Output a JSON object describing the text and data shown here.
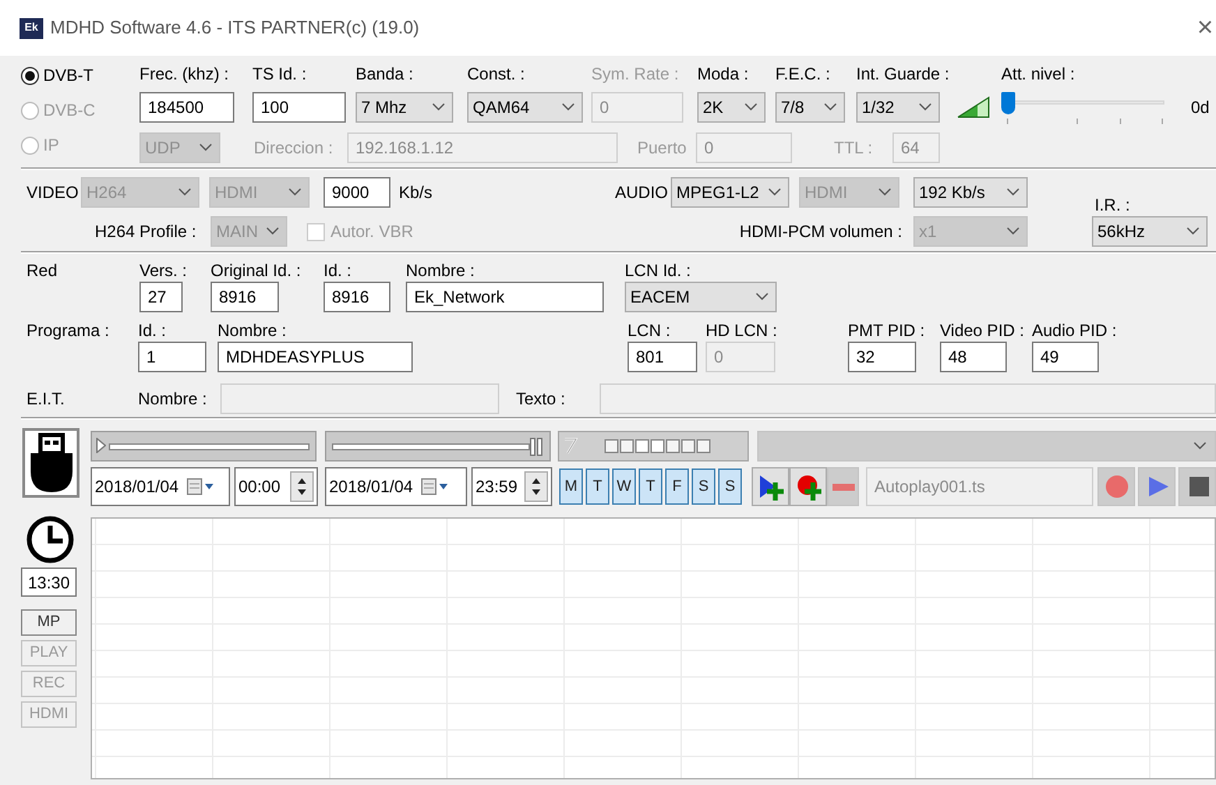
{
  "window": {
    "logo": "Ek",
    "title": "MDHD Software 4.6 - ITS PARTNER(c) (19.0)",
    "close": "×"
  },
  "modulation": {
    "sources": [
      {
        "label": "DVB-T",
        "selected": true,
        "disabled": false
      },
      {
        "label": "DVB-C",
        "selected": false,
        "disabled": true
      },
      {
        "label": "IP",
        "selected": false,
        "disabled": true
      }
    ],
    "fields": [
      {
        "kind": "input",
        "label": "Frec. (khz) :",
        "value": "184500",
        "disabled": false
      },
      {
        "kind": "input",
        "label": "TS Id. :",
        "value": "100",
        "disabled": false
      },
      {
        "kind": "select",
        "label": "Banda :",
        "value": "7 Mhz",
        "disabled": false
      },
      {
        "kind": "select",
        "label": "Const. :",
        "value": "QAM64",
        "disabled": false
      },
      {
        "kind": "input",
        "label": "Sym. Rate :",
        "value": "0",
        "disabled": true
      },
      {
        "kind": "select",
        "label": "Moda :",
        "value": "2K",
        "disabled": false
      },
      {
        "kind": "select",
        "label": "F.E.C. :",
        "value": "7/8",
        "disabled": false
      },
      {
        "kind": "select",
        "label": "Int. Guarde :",
        "value": "1/32",
        "disabled": false
      }
    ],
    "attenuation": {
      "label": "Att. nivel :",
      "level": 0,
      "reading": "0d"
    },
    "ip": {
      "disabled": true,
      "protocol": "UDP",
      "address_label": "Direccion :",
      "address": "192.168.1.12",
      "port_label": "Puerto",
      "port": "0",
      "ttl_label": "TTL :",
      "ttl": "64"
    }
  },
  "video": {
    "label": "VIDEO",
    "codec": {
      "value": "H264",
      "disabled": true
    },
    "input": {
      "value": "HDMI",
      "disabled": true
    },
    "bitrate": "9000",
    "unit": "Kb/s",
    "profile": {
      "label": "H264 Profile :",
      "value": "MAIN",
      "disabled": true
    },
    "vbr": {
      "label": "Autor. VBR",
      "checked": false,
      "disabled": true
    }
  },
  "audio": {
    "label": "AUDIO",
    "codec": {
      "value": "MPEG1-L2",
      "disabled": false
    },
    "input": {
      "value": "HDMI",
      "disabled": true
    },
    "bitrate": {
      "value": "192 Kb/s",
      "disabled": false
    },
    "volume": {
      "label": "HDMI-PCM volumen :",
      "value": "x1",
      "disabled": true
    },
    "ir": {
      "label": "I.R. :",
      "value": "56kHz",
      "disabled": false
    }
  },
  "network": {
    "label": "Red",
    "fields": [
      {
        "label": "Vers. :",
        "value": "27"
      },
      {
        "label": "Original Id. :",
        "value": "8916"
      },
      {
        "label": "Id. :",
        "value": "8916"
      },
      {
        "label": "Nombre :",
        "value": "Ek_Network"
      }
    ],
    "lcn_id": {
      "label": "LCN Id. :",
      "value": "EACEM",
      "disabled": false
    }
  },
  "program": {
    "label": "Programa :",
    "fields": [
      {
        "label": "Id. :",
        "value": "1"
      },
      {
        "label": "Nombre :",
        "value": "MDHDEASYPLUS"
      }
    ],
    "pids": [
      {
        "label": "LCN :",
        "value": "801",
        "disabled": false
      },
      {
        "label": "HD LCN :",
        "value": "0",
        "disabled": true
      },
      {
        "label": "PMT PID :",
        "value": "32",
        "disabled": false
      },
      {
        "label": "Video PID :",
        "value": "48",
        "disabled": false
      },
      {
        "label": "Audio PID :",
        "value": "49",
        "disabled": false
      }
    ]
  },
  "eit": {
    "label": "E.I.T.",
    "name_label": "Nombre :",
    "text_label": "Texto :",
    "disabled": true
  },
  "scheduler": {
    "clock": "13:30",
    "modes": [
      {
        "label": "MP",
        "disabled": false
      },
      {
        "label": "PLAY",
        "disabled": true
      },
      {
        "label": "REC",
        "disabled": true
      },
      {
        "label": "HDMI",
        "disabled": true
      }
    ],
    "range": [
      {
        "level": 0
      },
      {
        "level": 1
      }
    ],
    "start": {
      "date": "2018/01/04",
      "time": "00:00"
    },
    "end": {
      "date": "2018/01/04",
      "time": "23:59"
    },
    "days": [
      {
        "label": "M",
        "selected": true
      },
      {
        "label": "T",
        "selected": true
      },
      {
        "label": "W",
        "selected": true
      },
      {
        "label": "T",
        "selected": true
      },
      {
        "label": "F",
        "selected": true
      },
      {
        "label": "S",
        "selected": true
      },
      {
        "label": "S",
        "selected": true
      }
    ],
    "file": {
      "value": "Autoplay001.ts",
      "disabled": true
    }
  }
}
